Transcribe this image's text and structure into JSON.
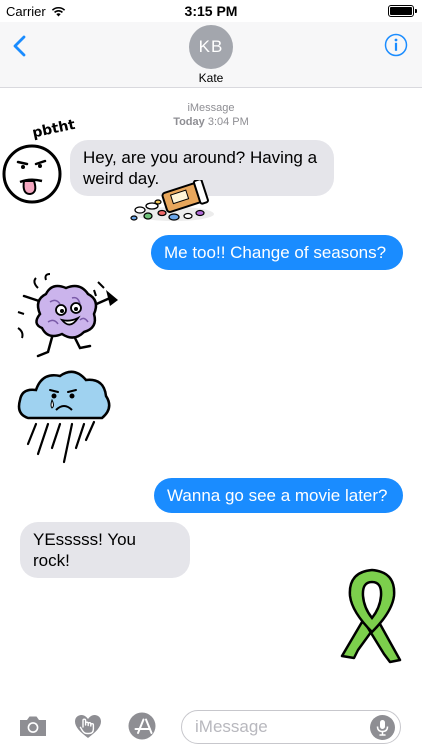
{
  "status_bar": {
    "carrier": "Carrier",
    "time": "3:15 PM",
    "battery_level": 1.0
  },
  "nav": {
    "back_icon": "chevron-left-icon",
    "avatar_initials": "KB",
    "contact_name": "Kate",
    "info_icon": "info-icon"
  },
  "meta": {
    "service": "iMessage",
    "day": "Today",
    "time": "3:04 PM"
  },
  "messages": [
    {
      "direction": "incoming",
      "text": "Hey, are you around? Having a weird day."
    },
    {
      "direction": "outgoing",
      "text": "Me too!! Change of seasons?"
    },
    {
      "direction": "outgoing",
      "text": "Wanna go see a movie later?"
    },
    {
      "direction": "incoming",
      "text": "YEsssss! You rock!"
    }
  ],
  "stickers": {
    "pbtht_face": {
      "caption": "pbtht"
    },
    "spilled_pills": {},
    "dancing_brain": {},
    "rain_cloud": {},
    "green_ribbon": {}
  },
  "input_bar": {
    "camera_icon": "camera-icon",
    "digital_touch_icon": "digital-touch-icon",
    "app_store_icon": "app-store-icon",
    "placeholder": "iMessage",
    "mic_icon": "microphone-icon"
  },
  "colors": {
    "accent": "#1a8cff",
    "incoming_bubble": "#e5e5ea",
    "outgoing_bubble": "#1a8cff",
    "ribbon": "#7ccf4c"
  }
}
